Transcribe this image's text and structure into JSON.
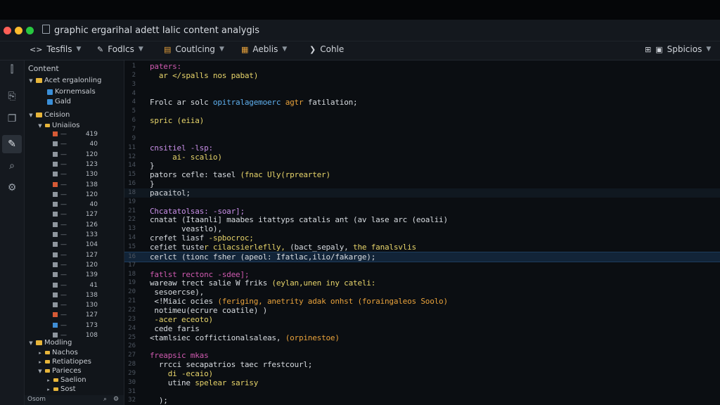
{
  "window": {
    "title": "graphic ergarihal adett Ialic content analygis",
    "traffic_lights": [
      "#ff5f57",
      "#febc2e",
      "#28c840"
    ]
  },
  "toolbar": {
    "items": [
      {
        "label": "Tesfils",
        "icon": "code-icon",
        "has_menu": true
      },
      {
        "label": "Fodlcs",
        "icon": "brush-icon",
        "has_menu": true
      },
      {
        "label": "Coutlcing",
        "icon": "layout-icon",
        "has_menu": true
      },
      {
        "label": "Aeblis",
        "icon": "grid-icon",
        "has_menu": true
      },
      {
        "label": "Cohle",
        "icon": "terminal-icon",
        "has_menu": false
      }
    ],
    "right": {
      "label": "Spbicios",
      "icons": [
        "layout-icon",
        "panel-icon"
      ],
      "has_menu": true
    }
  },
  "activity_bar": {
    "items": [
      "explorer-icon",
      "source-icon",
      "files-icon",
      "bookmark-icon",
      "edit-icon",
      "search-icon",
      "extensions-icon"
    ],
    "active_index": 4
  },
  "sidebar": {
    "header": "Content",
    "groups": [
      {
        "label": "Acet ergalonling",
        "children": [
          "Kornemsals",
          "Gald"
        ]
      },
      {
        "label": "Ceision",
        "subgroup": "Uniaiios",
        "values": [
          "419",
          "40",
          "120",
          "123",
          "130",
          "138",
          "120",
          "40",
          "127",
          "126",
          "133",
          "104",
          "127",
          "120",
          "139",
          "41",
          "138",
          "130",
          "127",
          "173",
          "108"
        ]
      },
      {
        "label": "Modling",
        "children": [
          "Nachos",
          "Retiatiopes"
        ],
        "subgroup": "Parieces",
        "subchildren": [
          "Saelion",
          "Sost"
        ]
      }
    ],
    "footer": {
      "label": "Osom",
      "icons": [
        "search-icon",
        "gear-icon"
      ]
    }
  },
  "editor": {
    "lines": [
      {
        "n": "1",
        "text": "paters:",
        "color": "pk"
      },
      {
        "n": "2",
        "text": "  ar </spalls nos pabat)",
        "color": "yl"
      },
      {
        "n": "3",
        "text": "",
        "color": "wh"
      },
      {
        "n": "4",
        "text": "",
        "color": "wh"
      },
      {
        "n": "4",
        "text": "Frolc ar solc opitralagemoerc agtr fatilation;",
        "color": "mix1"
      },
      {
        "n": "5",
        "text": "",
        "color": "wh"
      },
      {
        "n": "6",
        "text": "spric (eiia)",
        "color": "yl"
      },
      {
        "n": "7",
        "text": "",
        "color": "wh"
      },
      {
        "n": "9",
        "text": "",
        "color": "wh"
      },
      {
        "n": "11",
        "text": "cnsitiel -lsp:",
        "color": "pu"
      },
      {
        "n": "12",
        "text": "     ai- scalio)",
        "color": "yl"
      },
      {
        "n": "14",
        "text": "}",
        "color": "wh"
      },
      {
        "n": "15",
        "text": "pators cefle: tasel (fnac Uly(rprearter)",
        "color": "mix2"
      },
      {
        "n": "16",
        "text": "}",
        "color": "wh"
      },
      {
        "n": "18",
        "text": "pacaitol;",
        "color": "wh"
      },
      {
        "n": "19",
        "text": "",
        "color": "wh"
      },
      {
        "n": "21",
        "text": "Chcatatolsas: -soar];",
        "color": "pu"
      },
      {
        "n": "22",
        "text": "cnatat (Itaanli] maabes itattyps catalis ant (av lase arc (eoalii)",
        "color": "wh"
      },
      {
        "n": "13",
        "text": "       veastlo),",
        "color": "wh"
      },
      {
        "n": "14",
        "text": "crefet liasf -spbocroc;",
        "color": "mix3"
      },
      {
        "n": "15",
        "text": "cefiet tuster cilacsierleflly, (bact_sepaly, the fanalsvlis",
        "color": "mix4"
      },
      {
        "n": "16",
        "text": "cerlct (tionc fsher (apeol: Ifatlac,ilio/fakarge);",
        "color": "wh"
      },
      {
        "n": "17",
        "text": "",
        "color": "wh"
      },
      {
        "n": "18",
        "text": "fatlst rectonc -sdee];",
        "color": "pk"
      },
      {
        "n": "19",
        "text": "wareaw trect salie W friks (eylan,unen iny cateli:",
        "color": "mix5"
      },
      {
        "n": "20",
        "text": " sesoercse),",
        "color": "wh"
      },
      {
        "n": "21",
        "text": " <!Miaic ocies (feriging, anetrity adak onhst (foraingaleos Soolo)",
        "color": "mix6"
      },
      {
        "n": "22",
        "text": " notimeu(ecrure coatile) )",
        "color": "wh"
      },
      {
        "n": "23",
        "text": " -acer eceoto)",
        "color": "yl"
      },
      {
        "n": "24",
        "text": " cede faris",
        "color": "wh"
      },
      {
        "n": "25",
        "text": "<tamlsiec coffictionalsaleas, (orpinestoe)",
        "color": "mix7"
      },
      {
        "n": "26",
        "text": "",
        "color": "wh"
      },
      {
        "n": "27",
        "text": "freapsic mkas",
        "color": "pk"
      },
      {
        "n": "28",
        "text": "  rrcci secapatrios taec rfestcourl;",
        "color": "wh"
      },
      {
        "n": "29",
        "text": "    di -ecaio)",
        "color": "yl"
      },
      {
        "n": "30",
        "text": "    utine spelear sarisy",
        "color": "mix8"
      },
      {
        "n": "31",
        "text": "",
        "color": "wh"
      },
      {
        "n": "32",
        "text": "  );",
        "color": "wh"
      }
    ],
    "highlight_index": 21,
    "soft_highlight_index": 14
  }
}
